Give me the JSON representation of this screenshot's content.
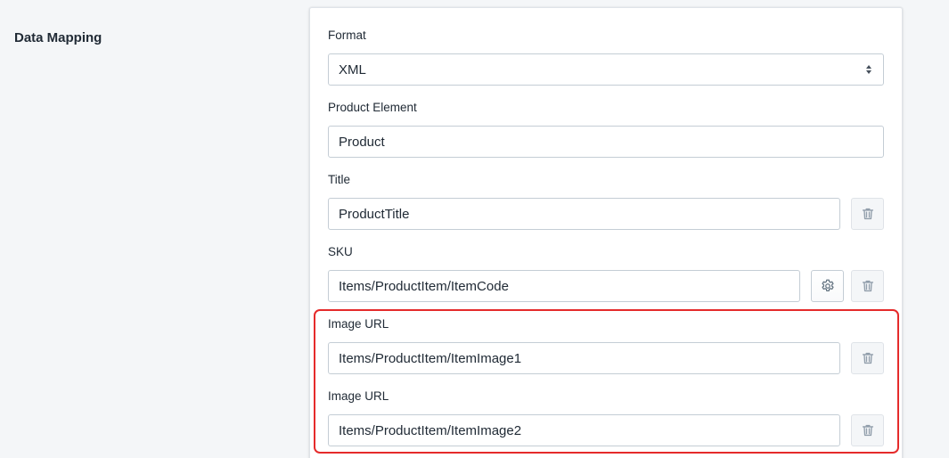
{
  "section": {
    "title": "Data Mapping"
  },
  "format": {
    "label": "Format",
    "value": "XML"
  },
  "product_element": {
    "label": "Product Element",
    "value": "Product"
  },
  "title_field": {
    "label": "Title",
    "value": "ProductTitle"
  },
  "sku": {
    "label": "SKU",
    "value": "Items/ProductItem/ItemCode"
  },
  "image_urls": [
    {
      "label": "Image URL",
      "value": "Items/ProductItem/ItemImage1"
    },
    {
      "label": "Image URL",
      "value": "Items/ProductItem/ItemImage2"
    }
  ],
  "icons": {
    "delete": "trash-icon",
    "settings": "gear-icon",
    "select": "select-arrows-icon"
  },
  "colors": {
    "highlight": "#e52b2b",
    "border": "#c4cdd5",
    "icon": "#919eab"
  }
}
